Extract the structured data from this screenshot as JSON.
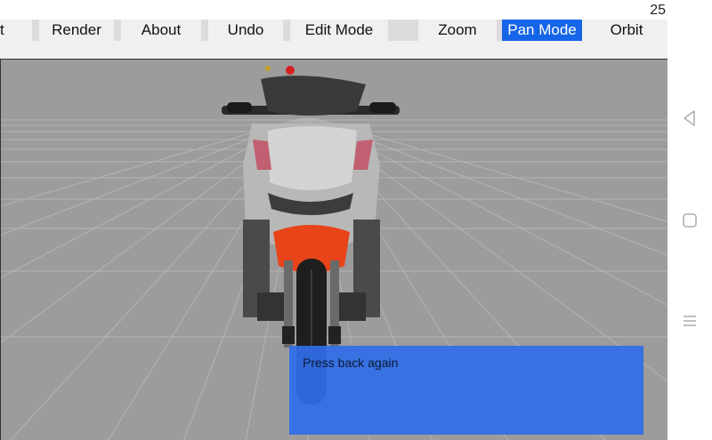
{
  "status_bar": {
    "clock": "25"
  },
  "toolbar": {
    "items": [
      {
        "label": "t",
        "active": false
      },
      {
        "label": "Render",
        "active": false
      },
      {
        "label": "About",
        "active": false
      },
      {
        "label": "Undo",
        "active": false
      },
      {
        "label": "Edit Mode",
        "active": false
      },
      {
        "label": "Zoom",
        "active": false
      },
      {
        "label": "Pan Mode",
        "active": true
      },
      {
        "label": "Orbit",
        "active": false
      }
    ]
  },
  "toast": {
    "message": "Press back again"
  },
  "navigation": {
    "buttons": [
      "back-icon",
      "home-icon",
      "menu-icon"
    ]
  },
  "colors": {
    "active_tab": "#1565e8",
    "viewport_bg": "#9c9c9c",
    "toast_bg": "#306ee8",
    "fairing_accent": "#e8441a"
  }
}
